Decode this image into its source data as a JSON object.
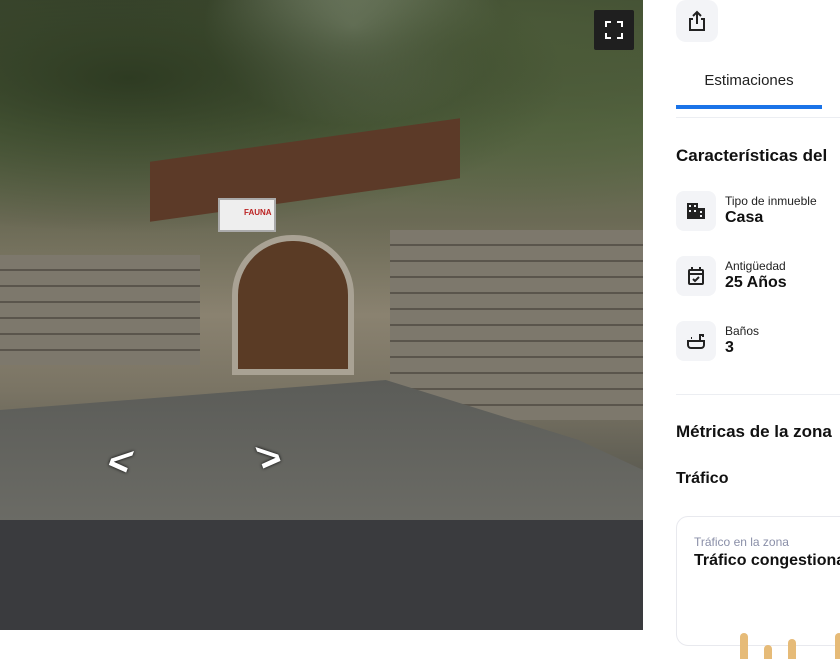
{
  "photo": {
    "sign_text": "FAUNA",
    "fullscreen_icon": "expand-icon"
  },
  "panel": {
    "share_icon": "share-icon",
    "tabs": [
      {
        "label": "Estimaciones",
        "active": true
      }
    ],
    "features_title": "Características del",
    "features": [
      {
        "icon": "building-icon",
        "label": "Tipo de inmueble",
        "value": "Casa"
      },
      {
        "icon": "calendar-check-icon",
        "label": "Antigüedad",
        "value": "25 Años"
      },
      {
        "icon": "bathtub-icon",
        "label": "Baños",
        "value": "3"
      }
    ],
    "metrics_title": "Métricas de la zona",
    "traffic_title": "Tráfico",
    "traffic_card": {
      "subtitle": "Tráfico en la zona",
      "title": "Tráfico congestionado",
      "accent": "#e6bb78"
    }
  }
}
